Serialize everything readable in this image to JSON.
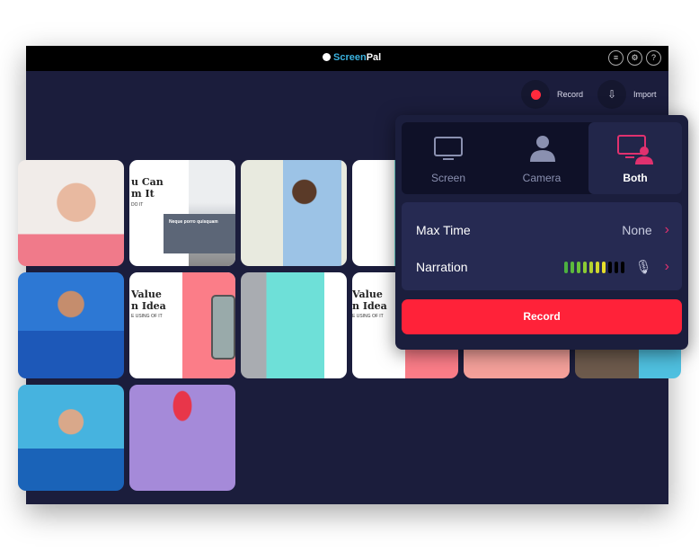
{
  "app": {
    "logo_prefix": "Screen",
    "logo_suffix": "Pal"
  },
  "titlebar_icons": [
    "checklist-icon",
    "gear-icon",
    "help-icon"
  ],
  "help_glyph": "?",
  "toolbar": {
    "record_label": "Record",
    "import_label": "Import"
  },
  "popup": {
    "modes": [
      {
        "label": "Screen",
        "icon": "monitor-icon"
      },
      {
        "label": "Camera",
        "icon": "person-icon"
      },
      {
        "label": "Both",
        "icon": "monitor-person-icon",
        "selected": true
      }
    ],
    "max_time": {
      "label": "Max Time",
      "value": "None"
    },
    "narration": {
      "label": "Narration",
      "level_bars_active": 7,
      "level_bars_total": 10
    },
    "record_label": "Record",
    "accent": "#e0316f",
    "record_color": "#ff2239"
  },
  "thumbnails": {
    "slide1": {
      "title1": "u Can",
      "title2": "m It",
      "sub": "DO IT",
      "box": "Neque porro quisquam"
    },
    "slide2": {
      "title1": "Value",
      "title2": "n Idea",
      "sub": "E USING OF IT"
    },
    "slide4": {
      "title1": "Value",
      "title2": "n Idea",
      "sub": "E USING OF IT"
    }
  }
}
